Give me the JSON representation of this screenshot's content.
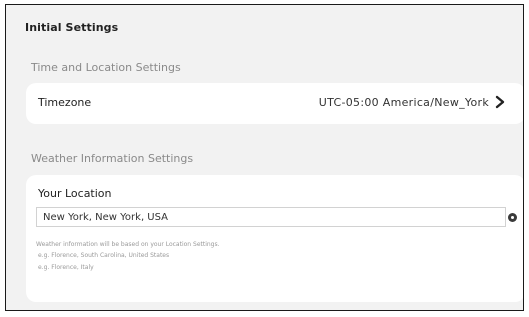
{
  "header": {
    "title": "Initial Settings"
  },
  "time_location": {
    "section_title": "Time and Location Settings",
    "timezone_label": "Timezone",
    "timezone_value": "UTC-05:00 America/New_York"
  },
  "weather": {
    "section_title": "Weather Information Settings",
    "location_label": "Your Location",
    "location_value": "New York, New York, USA",
    "help_line1": "Weather information will be based on your Location Settings.",
    "help_line2": "e.g. Florence, South Carolina, United States",
    "help_line3": "e.g. Florence, Italy"
  },
  "icons": {
    "chevron": "chevron-right-icon",
    "clear": "clear-input-icon"
  }
}
